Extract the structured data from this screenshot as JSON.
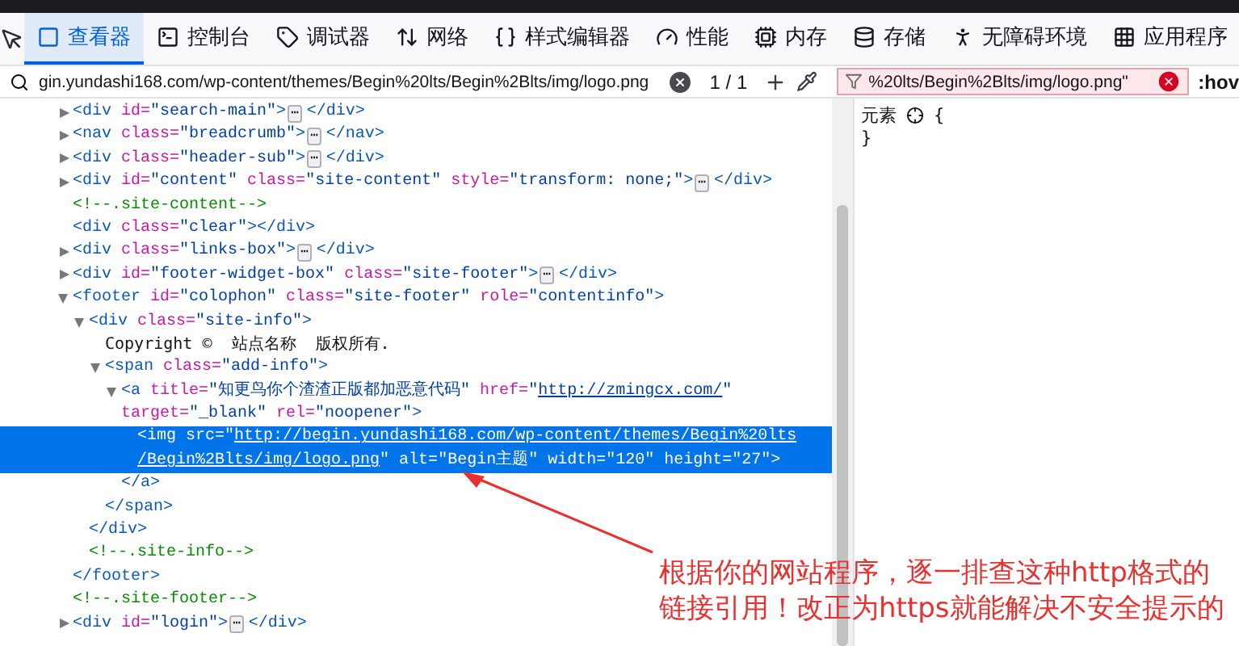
{
  "toolbar": {
    "tabs": [
      {
        "label": "查看器",
        "selected": true
      },
      {
        "label": "控制台",
        "selected": false
      },
      {
        "label": "调试器",
        "selected": false
      },
      {
        "label": "网络",
        "selected": false
      },
      {
        "label": "样式编辑器",
        "selected": false
      },
      {
        "label": "性能",
        "selected": false
      },
      {
        "label": "内存",
        "selected": false
      },
      {
        "label": "存储",
        "selected": false
      },
      {
        "label": "无障碍环境",
        "selected": false
      },
      {
        "label": "应用程序",
        "selected": false
      }
    ]
  },
  "search": {
    "value": "gin.yundashi168.com/wp-content/themes/Begin%20lts/Begin%2Blts/img/logo.png",
    "count": "1 / 1"
  },
  "filter": {
    "value": "%20lts/Begin%2Blts/img/logo.png\"",
    "invalid": true,
    "pseudo": ":hov"
  },
  "tree": [
    {
      "expanded": false,
      "selected": false,
      "lines": [
        [
          {
            "kind": "tag",
            "text": "<div"
          },
          {
            "kind": "attr",
            "text": " id="
          },
          {
            "kind": "value",
            "text": "\"search-main\""
          },
          {
            "kind": "tag",
            "text": ">"
          },
          {
            "kind": "badge",
            "text": "⋯"
          },
          {
            "kind": "tag",
            "text": "</div>"
          }
        ]
      ]
    },
    {
      "expanded": false,
      "selected": false,
      "lines": [
        [
          {
            "kind": "tag",
            "text": "<nav"
          },
          {
            "kind": "attr",
            "text": " class="
          },
          {
            "kind": "value",
            "text": "\"breadcrumb\""
          },
          {
            "kind": "tag",
            "text": ">"
          },
          {
            "kind": "badge",
            "text": "⋯"
          },
          {
            "kind": "tag",
            "text": "</nav>"
          }
        ]
      ]
    },
    {
      "expanded": false,
      "selected": false,
      "lines": [
        [
          {
            "kind": "tag",
            "text": "<div"
          },
          {
            "kind": "attr",
            "text": " class="
          },
          {
            "kind": "value",
            "text": "\"header-sub\""
          },
          {
            "kind": "tag",
            "text": ">"
          },
          {
            "kind": "badge",
            "text": "⋯"
          },
          {
            "kind": "tag",
            "text": "</div>"
          }
        ]
      ]
    },
    {
      "expanded": false,
      "selected": false,
      "lines": [
        [
          {
            "kind": "tag",
            "text": "<div"
          },
          {
            "kind": "attr",
            "text": " id="
          },
          {
            "kind": "value",
            "text": "\"content\""
          },
          {
            "kind": "attr",
            "text": " class="
          },
          {
            "kind": "value",
            "text": "\"site-content\""
          },
          {
            "kind": "attr",
            "text": " style="
          },
          {
            "kind": "value",
            "text": "\"transform: none;\""
          },
          {
            "kind": "tag",
            "text": ">"
          },
          {
            "kind": "badge",
            "text": "⋯"
          },
          {
            "kind": "tag",
            "text": "</div>"
          }
        ]
      ]
    },
    {
      "selected": false,
      "lines": [
        [
          {
            "kind": "comment",
            "text": "<!--.site-content-->"
          }
        ]
      ]
    },
    {
      "selected": false,
      "lines": [
        [
          {
            "kind": "tag",
            "text": "<div"
          },
          {
            "kind": "attr",
            "text": " class="
          },
          {
            "kind": "value",
            "text": "\"clear\""
          },
          {
            "kind": "tag",
            "text": "></div>"
          }
        ]
      ]
    },
    {
      "expanded": false,
      "selected": false,
      "lines": [
        [
          {
            "kind": "tag",
            "text": "<div"
          },
          {
            "kind": "attr",
            "text": " class="
          },
          {
            "kind": "value",
            "text": "\"links-box\""
          },
          {
            "kind": "tag",
            "text": ">"
          },
          {
            "kind": "badge",
            "text": "⋯"
          },
          {
            "kind": "tag",
            "text": "</div>"
          }
        ]
      ]
    },
    {
      "expanded": false,
      "selected": false,
      "lines": [
        [
          {
            "kind": "tag",
            "text": "<div"
          },
          {
            "kind": "attr",
            "text": " id="
          },
          {
            "kind": "value",
            "text": "\"footer-widget-box\""
          },
          {
            "kind": "attr",
            "text": " class="
          },
          {
            "kind": "value",
            "text": "\"site-footer\""
          },
          {
            "kind": "tag",
            "text": ">"
          },
          {
            "kind": "badge",
            "text": "⋯"
          },
          {
            "kind": "tag",
            "text": "</div>"
          }
        ]
      ]
    },
    {
      "expanded": true,
      "selected": false,
      "lines": [
        [
          {
            "kind": "tag",
            "text": "<footer"
          },
          {
            "kind": "attr",
            "text": " id="
          },
          {
            "kind": "value",
            "text": "\"colophon\""
          },
          {
            "kind": "attr",
            "text": " class="
          },
          {
            "kind": "value",
            "text": "\"site-footer\""
          },
          {
            "kind": "attr",
            "text": " role="
          },
          {
            "kind": "value",
            "text": "\"contentinfo\""
          },
          {
            "kind": "tag",
            "text": ">"
          }
        ]
      ],
      "closing": [
        {
          "kind": "tag",
          "text": "</footer>"
        }
      ],
      "children": [
        {
          "expanded": true,
          "selected": false,
          "lines": [
            [
              {
                "kind": "tag",
                "text": "<div"
              },
              {
                "kind": "attr",
                "text": " class="
              },
              {
                "kind": "value",
                "text": "\"site-info\""
              },
              {
                "kind": "tag",
                "text": ">"
              }
            ]
          ],
          "closing": [
            {
              "kind": "tag",
              "text": "</div>"
            }
          ],
          "children": [
            {
              "selected": false,
              "lines": [
                [
                  {
                    "kind": "text",
                    "text": "Copyright ©  站点名称  版权所有."
                  }
                ]
              ]
            },
            {
              "expanded": true,
              "selected": false,
              "lines": [
                [
                  {
                    "kind": "tag",
                    "text": "<span"
                  },
                  {
                    "kind": "attr",
                    "text": " class="
                  },
                  {
                    "kind": "value",
                    "text": "\"add-info\""
                  },
                  {
                    "kind": "tag",
                    "text": ">"
                  }
                ]
              ],
              "closing": [
                {
                  "kind": "tag",
                  "text": "</span>"
                }
              ],
              "children": [
                {
                  "expanded": true,
                  "selected": false,
                  "lines": [
                    [
                      {
                        "kind": "tag",
                        "text": "<a"
                      },
                      {
                        "kind": "attr",
                        "text": " title="
                      },
                      {
                        "kind": "value",
                        "text": "\"知更鸟你个渣渣正版都加恶意代码\""
                      },
                      {
                        "kind": "attr",
                        "text": " href="
                      },
                      {
                        "kind": "value",
                        "text": "\""
                      },
                      {
                        "kind": "link",
                        "text": "http://zmingcx.com/"
                      },
                      {
                        "kind": "value",
                        "text": "\""
                      }
                    ],
                    [
                      {
                        "kind": "attr",
                        "text": "target="
                      },
                      {
                        "kind": "value",
                        "text": "\"_blank\""
                      },
                      {
                        "kind": "attr",
                        "text": " rel="
                      },
                      {
                        "kind": "value",
                        "text": "\"noopener\""
                      },
                      {
                        "kind": "tag",
                        "text": ">"
                      }
                    ]
                  ],
                  "closing": [
                    {
                      "kind": "tag",
                      "text": "</a>"
                    }
                  ],
                  "children": [
                    {
                      "selected": true,
                      "lines": [
                        [
                          {
                            "kind": "tag",
                            "text": "<img"
                          },
                          {
                            "kind": "attr",
                            "text": " src="
                          },
                          {
                            "kind": "value",
                            "text": "\""
                          },
                          {
                            "kind": "link",
                            "text": "http://begin.yundashi168.com/wp-content/themes/Begin%20lts"
                          }
                        ],
                        [
                          {
                            "kind": "link",
                            "text": "/Begin%2Blts/img/logo.png"
                          },
                          {
                            "kind": "value",
                            "text": "\""
                          },
                          {
                            "kind": "attr",
                            "text": " alt="
                          },
                          {
                            "kind": "value",
                            "text": "\"Begin主题\""
                          },
                          {
                            "kind": "attr",
                            "text": " width="
                          },
                          {
                            "kind": "value",
                            "text": "\"120\""
                          },
                          {
                            "kind": "attr",
                            "text": " height="
                          },
                          {
                            "kind": "value",
                            "text": "\"27\""
                          },
                          {
                            "kind": "tag",
                            "text": ">"
                          }
                        ]
                      ]
                    }
                  ]
                }
              ]
            }
          ]
        },
        {
          "selected": false,
          "lines": [
            [
              {
                "kind": "comment",
                "text": "<!--.site-info-->"
              }
            ]
          ]
        }
      ]
    },
    {
      "selected": false,
      "lines": [
        [
          {
            "kind": "comment",
            "text": "<!--.site-footer-->"
          }
        ]
      ]
    },
    {
      "expanded": false,
      "selected": false,
      "lines": [
        [
          {
            "kind": "tag",
            "text": "<div"
          },
          {
            "kind": "attr",
            "text": " id="
          },
          {
            "kind": "value",
            "text": "\"login\""
          },
          {
            "kind": "tag",
            "text": ">"
          },
          {
            "kind": "badge",
            "text": "⋯"
          },
          {
            "kind": "tag",
            "text": "</div>"
          }
        ]
      ]
    }
  ],
  "rules": {
    "selector": "元素",
    "open": "{",
    "close": "}"
  },
  "annotation": {
    "lines": [
      "根据你的网站程序，逐一排查这种http格式的",
      "链接引用！改正为https就能解决不安全提示的"
    ]
  }
}
